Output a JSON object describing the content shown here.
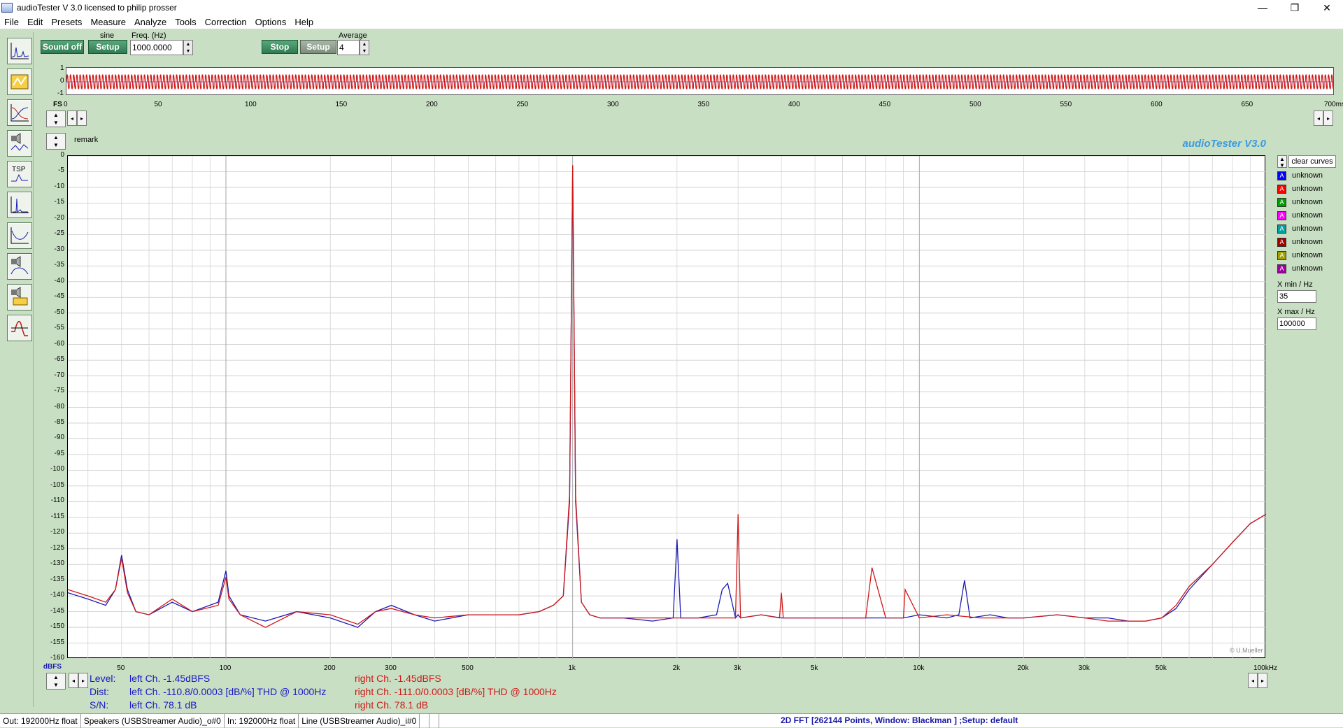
{
  "window": {
    "title": "audioTester  V 3.0   licensed to philip prosser",
    "controls": [
      "—",
      "❐",
      "✕"
    ]
  },
  "menu": [
    "File",
    "Edit",
    "Presets",
    "Measure",
    "Analyze",
    "Tools",
    "Correction",
    "Options",
    "Help"
  ],
  "generator": {
    "sound_button": "Sound off",
    "waveform": "sine",
    "setup_button": "Setup",
    "freq_label": "Freq. (Hz)",
    "freq_value": "1000.0000"
  },
  "analyzer": {
    "stop_button": "Stop",
    "setup_button": "Setup",
    "average_label": "Average",
    "average_value": "4"
  },
  "scope": {
    "y_labels": [
      "1",
      "0",
      "-1"
    ],
    "x_ticks": [
      "0",
      "50",
      "100",
      "150",
      "200",
      "250",
      "300",
      "350",
      "400",
      "450",
      "500",
      "550",
      "600",
      "650",
      "700ms"
    ],
    "fs_label": "FS"
  },
  "remark": "remark",
  "brand": "audioTester  V3.0",
  "watermark": "© U.Mueller",
  "legend": {
    "clear_button": "clear curves",
    "entries": [
      {
        "label": "unknown",
        "color": "#0000ff"
      },
      {
        "label": "unknown",
        "color": "#ff0000"
      },
      {
        "label": "unknown",
        "color": "#00a000"
      },
      {
        "label": "unknown",
        "color": "#ff00ff"
      },
      {
        "label": "unknown",
        "color": "#00a0a0"
      },
      {
        "label": "unknown",
        "color": "#a00000"
      },
      {
        "label": "unknown",
        "color": "#a0a000"
      },
      {
        "label": "unknown",
        "color": "#a000a0"
      }
    ],
    "xmin_label": "X min / Hz",
    "xmin_value": "35",
    "xmax_label": "X max / Hz",
    "xmax_value": "100000"
  },
  "readouts": {
    "level_label": "Level:",
    "dist_label": "Dist:",
    "sn_label": "S/N:",
    "left_level": "left Ch. -1.45dBFS",
    "left_dist": "left Ch. -110.8/0.0003 [dB/%] THD @ 1000Hz",
    "left_sn": "left Ch. 78.1 dB",
    "right_level": "right Ch. -1.45dBFS",
    "right_dist": "right Ch. -111.0/0.0003 [dB/%] THD @ 1000Hz",
    "right_sn": "right Ch. 78.1 dB"
  },
  "status": {
    "out": "Out: 192000Hz float",
    "speakers": "Speakers (USBStreamer Audio)_o#0",
    "in": "In: 192000Hz float",
    "line": "Line (USBStreamer Audio)_i#0",
    "fft": "2D FFT [262144 Points, Window: Blackman ] ;Setup:  default"
  },
  "chart_data": {
    "type": "line",
    "title": "",
    "xlabel": "",
    "ylabel": "dBFS",
    "x_scale": "log",
    "xlim": [
      35,
      100000
    ],
    "ylim": [
      -160,
      0
    ],
    "x_tick_labels": [
      "50",
      "100",
      "200",
      "300",
      "500",
      "1k",
      "2k",
      "3k",
      "5k",
      "10k",
      "20k",
      "30k",
      "50k",
      "100kHz"
    ],
    "x_tick_values": [
      50,
      100,
      200,
      300,
      500,
      1000,
      2000,
      3000,
      5000,
      10000,
      20000,
      30000,
      50000,
      100000
    ],
    "y_tick_labels": [
      "0",
      "-5",
      "-10",
      "-15",
      "-20",
      "-25",
      "-30",
      "-35",
      "-40",
      "-45",
      "-50",
      "-55",
      "-60",
      "-65",
      "-70",
      "-75",
      "-80",
      "-85",
      "-90",
      "-95",
      "-100",
      "-105",
      "-110",
      "-115",
      "-120",
      "-125",
      "-130",
      "-135",
      "-140",
      "-145",
      "-150",
      "-155",
      "-160"
    ],
    "grid": true,
    "series": [
      {
        "color": "#1a1ab4",
        "x": [
          35,
          40,
          45,
          48,
          50,
          52,
          55,
          60,
          70,
          80,
          95,
          100,
          102,
          110,
          130,
          160,
          200,
          240,
          270,
          300,
          350,
          400,
          500,
          600,
          700,
          800,
          880,
          940,
          980,
          1000,
          1020,
          1060,
          1120,
          1200,
          1400,
          1700,
          1950,
          2000,
          2050,
          2300,
          2600,
          2700,
          2800,
          2950,
          3000,
          3050,
          3500,
          4000,
          5000,
          6000,
          7000,
          8000,
          9000,
          10000,
          12000,
          13000,
          13500,
          14000,
          16000,
          18000,
          20000,
          25000,
          30000,
          35000,
          40000,
          45000,
          50000,
          55000,
          60000,
          70000,
          80000,
          90000,
          100000
        ],
        "y": [
          -139,
          -141,
          -143,
          -138,
          -127,
          -138,
          -145,
          -146,
          -142,
          -145,
          -142,
          -132,
          -140,
          -146,
          -148,
          -145,
          -147,
          -150,
          -145,
          -143,
          -146,
          -148,
          -146,
          -146,
          -146,
          -145,
          -143,
          -140,
          -110,
          -3,
          -110,
          -142,
          -146,
          -147,
          -147,
          -148,
          -147,
          -122,
          -147,
          -147,
          -146,
          -138,
          -136,
          -147,
          -146,
          -147,
          -146,
          -147,
          -147,
          -147,
          -147,
          -147,
          -147,
          -146,
          -147,
          -146,
          -135,
          -147,
          -146,
          -147,
          -147,
          -146,
          -147,
          -147,
          -148,
          -148,
          -147,
          -144,
          -138,
          -130,
          -123,
          -117,
          -114
        ]
      },
      {
        "color": "#d01818",
        "x": [
          35,
          40,
          45,
          48,
          50,
          52,
          55,
          60,
          70,
          80,
          95,
          100,
          102,
          110,
          130,
          160,
          200,
          240,
          270,
          300,
          350,
          400,
          500,
          600,
          700,
          800,
          880,
          940,
          980,
          1000,
          1020,
          1060,
          1120,
          1200,
          1400,
          1700,
          2000,
          2300,
          2600,
          2800,
          2950,
          3000,
          3050,
          3500,
          3950,
          4000,
          4050,
          5000,
          6000,
          7000,
          7300,
          8000,
          9000,
          9100,
          10000,
          12000,
          15000,
          18000,
          20000,
          25000,
          30000,
          35000,
          40000,
          45000,
          50000,
          55000,
          60000,
          70000,
          80000,
          90000,
          100000
        ],
        "y": [
          -138,
          -140,
          -142,
          -138,
          -128,
          -139,
          -145,
          -146,
          -141,
          -145,
          -143,
          -134,
          -141,
          -146,
          -150,
          -145,
          -146,
          -149,
          -145,
          -144,
          -146,
          -147,
          -146,
          -146,
          -146,
          -145,
          -143,
          -140,
          -108,
          -3,
          -108,
          -142,
          -146,
          -147,
          -147,
          -147,
          -147,
          -147,
          -147,
          -147,
          -147,
          -114,
          -147,
          -146,
          -147,
          -139,
          -147,
          -147,
          -147,
          -147,
          -131,
          -147,
          -147,
          -138,
          -147,
          -146,
          -147,
          -147,
          -147,
          -146,
          -147,
          -148,
          -148,
          -148,
          -147,
          -143,
          -137,
          -130,
          -123,
          -117,
          -114
        ]
      }
    ]
  }
}
